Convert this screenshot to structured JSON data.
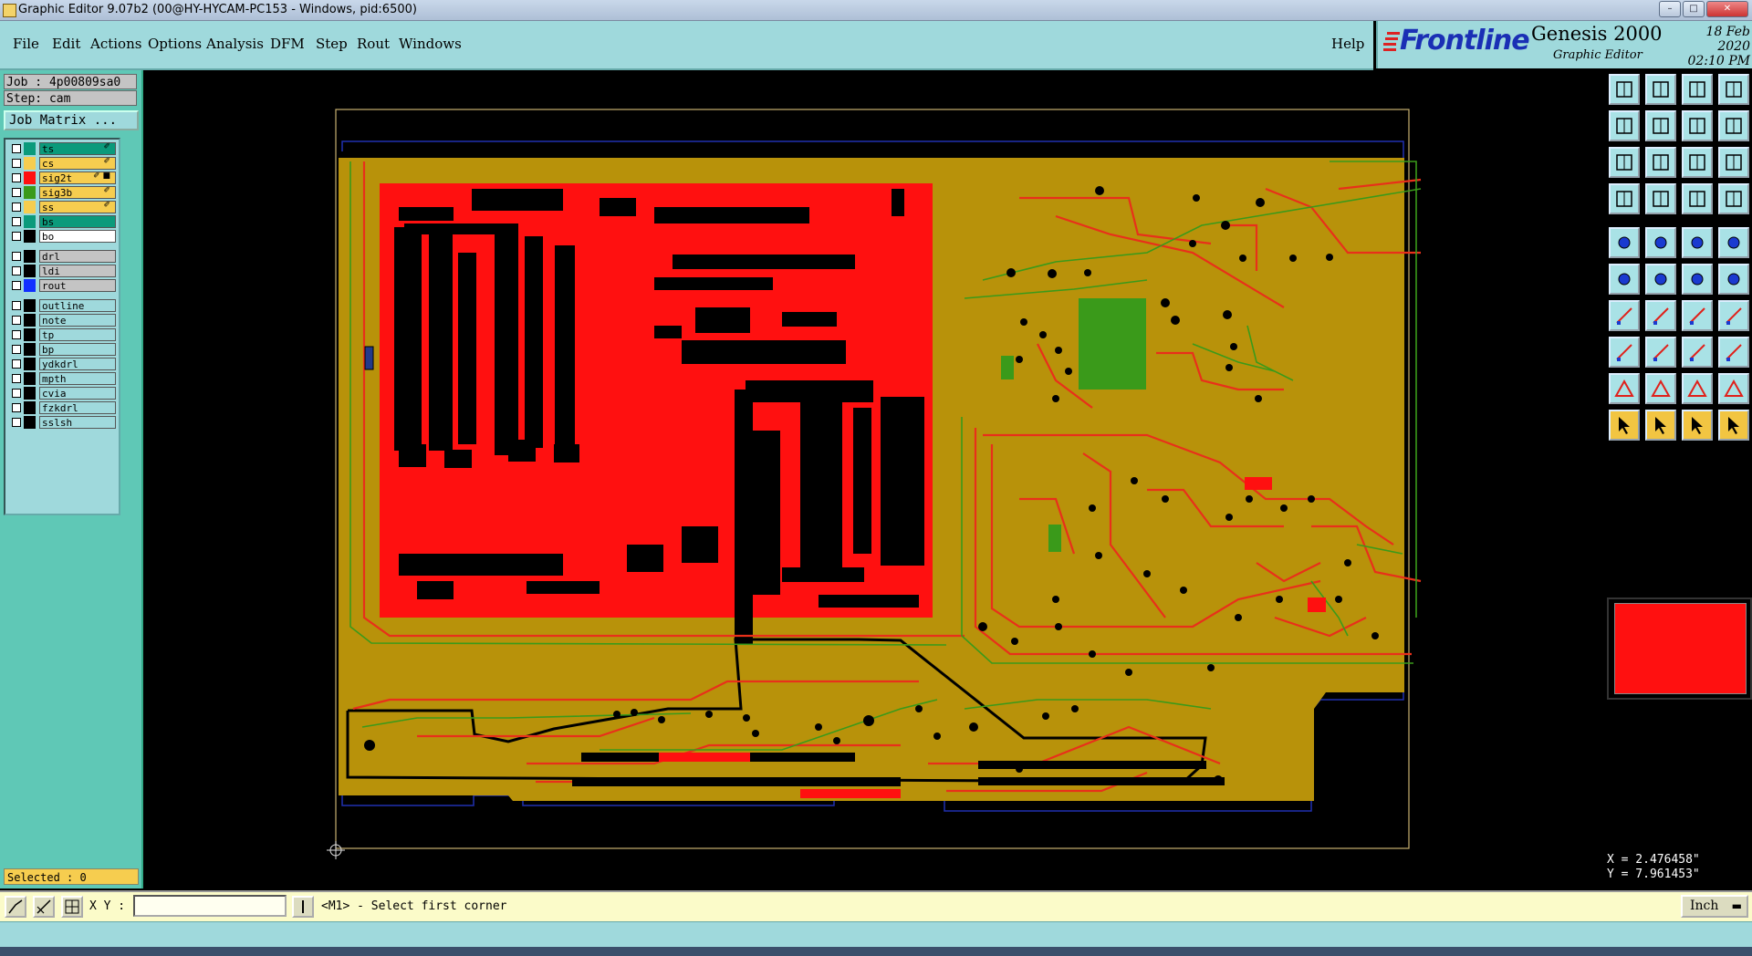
{
  "window": {
    "title": "Graphic Editor 9.07b2 (00@HY-HYCAM-PC153 - Windows, pid:6500)"
  },
  "menu": [
    {
      "label": "File"
    },
    {
      "label": "Edit"
    },
    {
      "label": "Actions"
    },
    {
      "label": "Options"
    },
    {
      "label": "Analysis"
    },
    {
      "label": "DFM"
    },
    {
      "label": "Step"
    },
    {
      "label": "Rout"
    },
    {
      "label": "Windows"
    }
  ],
  "help_label": "Help",
  "brand": {
    "logo": "Frontline",
    "product": "Genesis 2000",
    "subtitle": "Graphic Editor",
    "date": "18 Feb 2020",
    "time": "02:10 PM"
  },
  "job": {
    "job_label": "Job : 4p00809sa0",
    "step_label": "Step: cam",
    "matrix_button": "Job Matrix ..."
  },
  "layers": [
    {
      "name": "ts",
      "color": "#0b9a7b",
      "bg": "#0b9a7b",
      "mark": "✐"
    },
    {
      "name": "cs",
      "color": "#f6cd4f",
      "bg": "#f6cd4f",
      "mark": "✐"
    },
    {
      "name": "sig2t",
      "color": "#ff1010",
      "bg": "#f6cd4f",
      "mark": "✐ ■"
    },
    {
      "name": "sig3b",
      "color": "#3a9a1a",
      "bg": "#f6cd4f",
      "mark": "✐"
    },
    {
      "name": "ss",
      "color": "#f6cd4f",
      "bg": "#f6cd4f",
      "mark": "✐"
    },
    {
      "name": "bs",
      "color": "#0b9a7b",
      "bg": "#0b9a7b",
      "mark": ""
    },
    {
      "name": "bo",
      "color": "#ffffff",
      "bg": "#ffffff",
      "mark": ""
    },
    {
      "name": "drl",
      "color": "#c4c4c4",
      "bg": "#c4c4c4",
      "mark": ""
    },
    {
      "name": "ldi",
      "color": "#c4c4c4",
      "bg": "#c4c4c4",
      "mark": ""
    },
    {
      "name": "rout",
      "color": "#1030ff",
      "bg": "#c4c4c4",
      "mark": ""
    },
    {
      "name": "outline",
      "color": "#9fd9dc",
      "bg": "#9fd9dc",
      "mark": ""
    },
    {
      "name": "note",
      "color": "#9fd9dc",
      "bg": "#9fd9dc",
      "mark": ""
    },
    {
      "name": "tp",
      "color": "#9fd9dc",
      "bg": "#9fd9dc",
      "mark": ""
    },
    {
      "name": "bp",
      "color": "#9fd9dc",
      "bg": "#9fd9dc",
      "mark": ""
    },
    {
      "name": "ydkdrl",
      "color": "#9fd9dc",
      "bg": "#9fd9dc",
      "mark": ""
    },
    {
      "name": "mpth",
      "color": "#9fd9dc",
      "bg": "#9fd9dc",
      "mark": ""
    },
    {
      "name": "cvia",
      "color": "#9fd9dc",
      "bg": "#9fd9dc",
      "mark": ""
    },
    {
      "name": "fzkdrl",
      "color": "#9fd9dc",
      "bg": "#9fd9dc",
      "mark": ""
    },
    {
      "name": "sslsh",
      "color": "#9fd9dc",
      "bg": "#9fd9dc",
      "mark": ""
    }
  ],
  "selected_label": "Selected : 0",
  "coords": {
    "x": "X = 2.476458\"",
    "y": "Y = 7.961453\""
  },
  "status": {
    "xy_label": "X Y :",
    "xy_value": "",
    "prompt": "<M1> - Select first corner",
    "unit": "Inch"
  },
  "colors": {
    "board": "#b8920a",
    "copper_red": "#ff1010",
    "green": "#3a9a1a",
    "panel": "#5fc8b6"
  }
}
